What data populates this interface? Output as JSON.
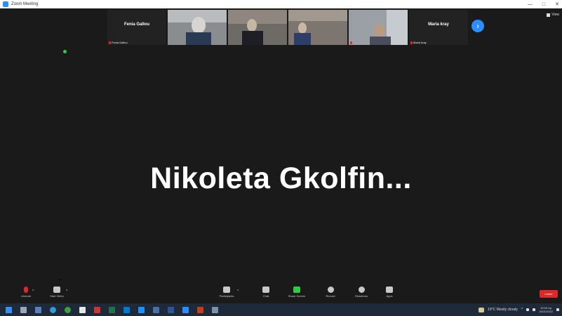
{
  "window": {
    "title": "Zoom Meeting",
    "controls": [
      "—",
      "□",
      "✕"
    ]
  },
  "view": {
    "label": "View"
  },
  "gallery": [
    {
      "type": "name",
      "big_name": "Fenia Gallou",
      "label": "Fenia Gallou",
      "muted": true
    },
    {
      "type": "video",
      "label": "",
      "muted": false,
      "colors": [
        "#8a8d90",
        "#d8d4cf",
        "#2a3a55"
      ]
    },
    {
      "type": "video",
      "label": "",
      "muted": false,
      "colors": [
        "#6e6a66",
        "#c7b7a2",
        "#1d1f24"
      ]
    },
    {
      "type": "video",
      "label": "",
      "muted": false,
      "colors": [
        "#7d7670",
        "#c8b7a2",
        "#2d3f66"
      ]
    },
    {
      "type": "video",
      "label": "",
      "muted": true,
      "colors": [
        "#9aa0a5",
        "#b89b85",
        "#4a4e5c"
      ]
    },
    {
      "type": "name",
      "big_name": "Maria kray",
      "label": "Maria kray",
      "muted": true
    }
  ],
  "active_speaker": {
    "name": "Nikoleta Gkolfin..."
  },
  "toolbar": {
    "items": [
      {
        "label": "Unmute"
      },
      {
        "label": "Start Video"
      },
      {
        "label": "Participants"
      },
      {
        "label": "Chat"
      },
      {
        "label": "Share Screen"
      },
      {
        "label": "Record"
      },
      {
        "label": "Reactions"
      },
      {
        "label": "Apps"
      }
    ],
    "end_label": "Leave"
  },
  "taskbar": {
    "weather": "19°C Mostly cloudy",
    "time": "10:03 πμ",
    "date": "16/11/2022"
  },
  "colors": {
    "accent": "#2d8cff",
    "danger": "#e02828",
    "share": "#2ecc40"
  }
}
